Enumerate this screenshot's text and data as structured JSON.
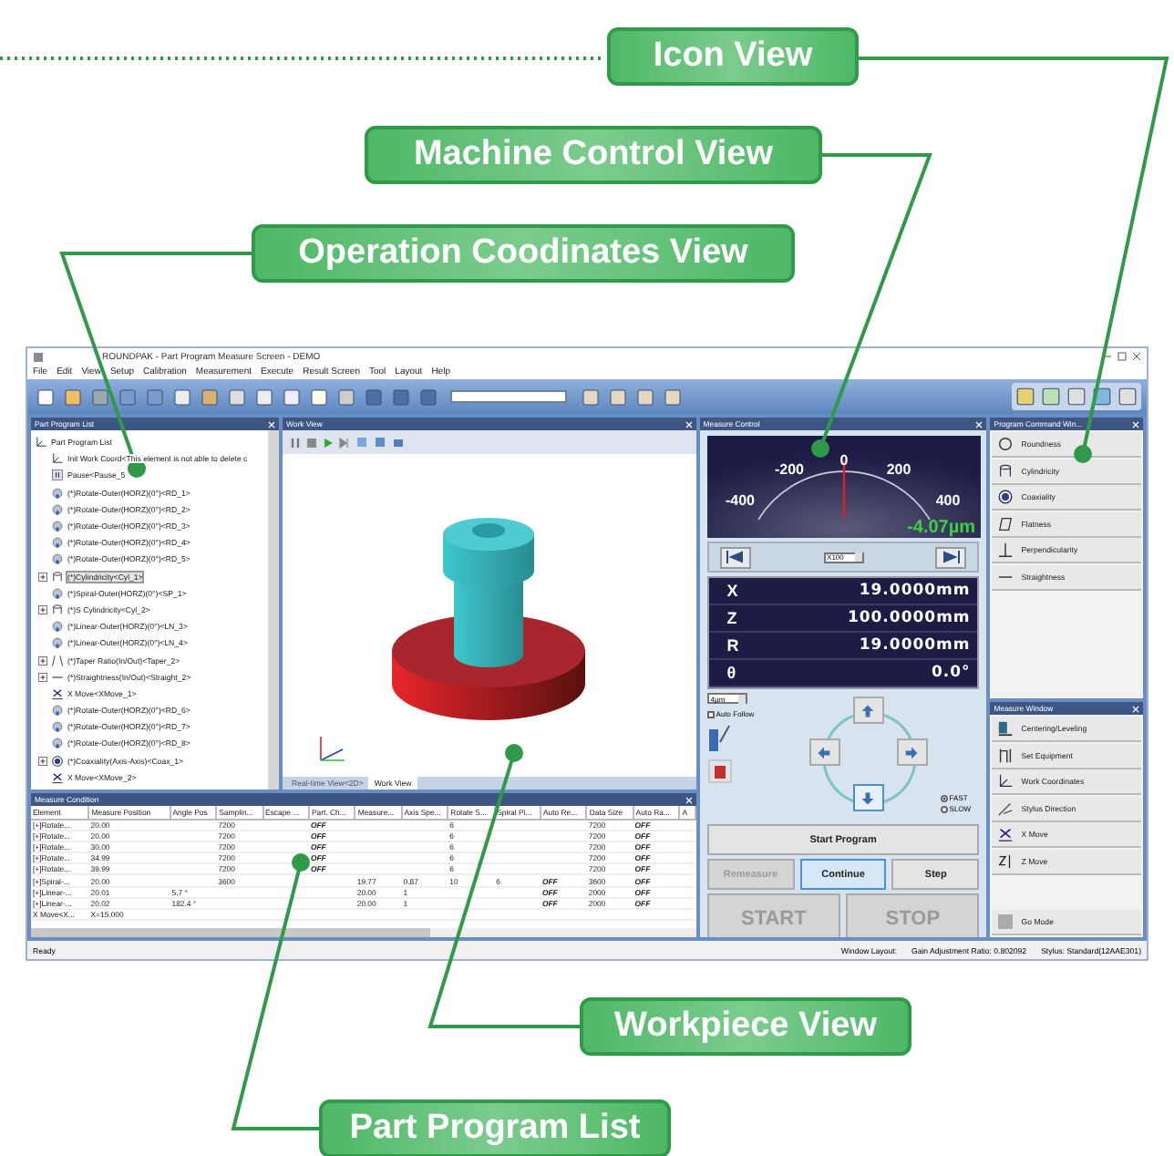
{
  "window": {
    "title": "ROUNDPAK - Part Program Measure Screen - DEMO"
  },
  "menu": [
    "File",
    "Edit",
    "View",
    "Setup",
    "Calibration",
    "Measurement",
    "Execute",
    "Result Screen",
    "Tool",
    "Layout",
    "Help"
  ],
  "part_program_list": {
    "title": "Part Program List",
    "root": {
      "label": "Part Program List",
      "children": [
        {
          "label": "Init Work Coord<This element is not able to delete c",
          "kind": "coord",
          "selected": false
        },
        {
          "label": "Pause<Pause_5",
          "kind": "pause",
          "selected": false
        },
        {
          "label": "(*)Rotate-Outer(HORZ)(0°)<RD_1>",
          "kind": "rotate",
          "selected": false
        },
        {
          "label": "(*)Rotate-Outer(HORZ)(0°)<RD_2>",
          "kind": "rotate",
          "selected": false
        },
        {
          "label": "(*)Rotate-Outer(HORZ)(0°)<RD_3>",
          "kind": "rotate",
          "selected": false
        },
        {
          "label": "(*)Rotate-Outer(HORZ)(0°)<RD_4>",
          "kind": "rotate",
          "selected": false
        },
        {
          "label": "(*)Rotate-Outer(HORZ)(0°)<RD_5>",
          "kind": "rotate",
          "selected": false
        },
        {
          "label": "(*)Cylindricity<Cyl_1>",
          "kind": "cylindricity",
          "selected": true,
          "expanded": false
        },
        {
          "label": "(*)Spiral-Outer(HORZ)(0°)<SP_1>",
          "kind": "rotate",
          "selected": false
        },
        {
          "label": "(*)S Cylindricity<Cyl_2>",
          "kind": "cylindricity",
          "selected": false,
          "expanded": false
        },
        {
          "label": "(*)Linear-Outer(HORZ)(0°)<LN_3>",
          "kind": "rotate",
          "selected": false
        },
        {
          "label": "(*)Linear-Outer(HORZ)(0°)<LN_4>",
          "kind": "rotate",
          "selected": false
        },
        {
          "label": "(*)Taper Ratio(In/Out)<Taper_2>",
          "kind": "taper",
          "selected": false,
          "expanded": false
        },
        {
          "label": "(*)Straightness(In/Out)<Straight_2>",
          "kind": "straightness",
          "selected": false,
          "expanded": false
        },
        {
          "label": "X Move<XMove_1>",
          "kind": "move",
          "selected": false
        },
        {
          "label": "(*)Rotate-Outer(HORZ)(0°)<RD_6>",
          "kind": "rotate",
          "selected": false
        },
        {
          "label": "(*)Rotate-Outer(HORZ)(0°)<RD_7>",
          "kind": "rotate",
          "selected": false
        },
        {
          "label": "(*)Rotate-Outer(HORZ)(0°)<RD_8>",
          "kind": "rotate",
          "selected": false
        },
        {
          "label": "(*)Coaxiality(Axis-Axis)<Coax_1>",
          "kind": "coaxiality",
          "selected": false,
          "expanded": false
        },
        {
          "label": "X Move<XMove_2>",
          "kind": "move",
          "selected": false
        }
      ]
    }
  },
  "work_view": {
    "title": "Work View",
    "tabs": [
      {
        "label": "Real-time View<2D>",
        "selected": false
      },
      {
        "label": "Work View",
        "selected": true
      }
    ]
  },
  "measure_condition": {
    "title": "Measure Condition",
    "columns": [
      "Element",
      "Measure Position",
      "Angle Pos",
      "Samplin...",
      "Escape ...",
      "Part. Ch...",
      "Measure...",
      "Axis Spe...",
      "Rotate S...",
      "Spiral Pi...",
      "Auto Re...",
      "Data Size",
      "Auto Ra...",
      "A"
    ],
    "rows": [
      [
        "[+]Rotate...",
        "20.00",
        null,
        "7200",
        null,
        "OFF",
        null,
        null,
        "6",
        null,
        null,
        "7200",
        "OFF"
      ],
      [
        "[+]Rotate...",
        "20.00",
        null,
        "7200",
        null,
        "OFF",
        null,
        null,
        "6",
        null,
        null,
        "7200",
        "OFF"
      ],
      [
        "[+]Rotate...",
        "30.00",
        null,
        "7200",
        null,
        "OFF",
        null,
        null,
        "6",
        null,
        null,
        "7200",
        "OFF"
      ],
      [
        "[+]Rotate...",
        "34.99",
        null,
        "7200",
        null,
        "OFF",
        null,
        null,
        "6",
        null,
        null,
        "7200",
        "OFF"
      ],
      [
        "[+]Rotate...",
        "39.99",
        null,
        "7200",
        null,
        "OFF",
        null,
        null,
        "6",
        null,
        null,
        "7200",
        "OFF"
      ],
      [
        "[+]Spiral-...",
        "20.00",
        null,
        "3600",
        null,
        null,
        "19.77",
        "0.87",
        "10",
        "6",
        "OFF",
        "3600",
        "OFF"
      ],
      [
        "[+]Linear-...",
        "20.01",
        "5.7 °",
        null,
        null,
        null,
        "20.00",
        "1",
        null,
        null,
        "OFF",
        "2000",
        "OFF"
      ],
      [
        "[+]Linear-...",
        "20.02",
        "182.4 °",
        null,
        null,
        null,
        "20.00",
        "1",
        null,
        null,
        "OFF",
        "2000",
        "OFF"
      ],
      [
        "X Move<X...",
        "X=15.000"
      ]
    ]
  },
  "measure_control": {
    "title": "Measure Control",
    "gauge": {
      "scale": [
        "-400",
        "-200",
        "0",
        "200",
        "400"
      ],
      "reading": "-4.07µm"
    },
    "magnification": "X100",
    "readouts": [
      {
        "axis": "X",
        "value": "19.0000mm"
      },
      {
        "axis": "Z",
        "value": "100.0000mm"
      },
      {
        "axis": "R",
        "value": "19.0000mm"
      },
      {
        "axis": "θ",
        "value": "0.0°"
      }
    ],
    "step_unit": "4µm",
    "auto_follow": {
      "label": "Auto Follow",
      "checked": false
    },
    "speed": [
      {
        "label": "FAST",
        "selected": true
      },
      {
        "label": "SLOW",
        "selected": false
      }
    ],
    "start_program": "Start Program",
    "actions": [
      {
        "label": "Remeasure",
        "disabled": true,
        "highlighted": false
      },
      {
        "label": "Continue",
        "disabled": false,
        "highlighted": true
      },
      {
        "label": "Step",
        "disabled": false,
        "highlighted": false
      }
    ],
    "run_buttons": [
      {
        "label": "START",
        "disabled": true
      },
      {
        "label": "STOP",
        "disabled": true
      }
    ]
  },
  "program_command_window": {
    "title": "Program Command Win...",
    "items": [
      {
        "label": "Roundness",
        "kind": "roundness"
      },
      {
        "label": "Cylindricity",
        "kind": "cylindricity"
      },
      {
        "label": "Coaxiality",
        "kind": "coaxiality"
      },
      {
        "label": "Flatness",
        "kind": "flatness"
      },
      {
        "label": "Perpendicularity",
        "kind": "perpendicularity"
      },
      {
        "label": "Straightness",
        "kind": "straightness"
      }
    ]
  },
  "measure_window": {
    "title": "Measure Window",
    "items": [
      {
        "label": "Centering/Leveling",
        "kind": "centering"
      },
      {
        "label": "Set Equipment",
        "kind": "equipment"
      },
      {
        "label": "Work Coordinates",
        "kind": "coordinates"
      },
      {
        "label": "Stylus Direction",
        "kind": "stylus"
      },
      {
        "label": "X Move",
        "kind": "x_move"
      },
      {
        "label": "Z Move",
        "kind": "z_move"
      }
    ],
    "go_mode": "Go Mode"
  },
  "status_bar": {
    "message": "Ready",
    "layout": "Window Layout:",
    "gain": "Gain Adjustment Ratio:  0.802092",
    "stylus": "Stylus:  Standard(12AAE301)"
  },
  "callouts": [
    {
      "label": "Icon View"
    },
    {
      "label": "Machine Control View"
    },
    {
      "label": "Operation Coodinates View"
    },
    {
      "label": "Workpiece View"
    },
    {
      "label": "Part Program List"
    }
  ]
}
